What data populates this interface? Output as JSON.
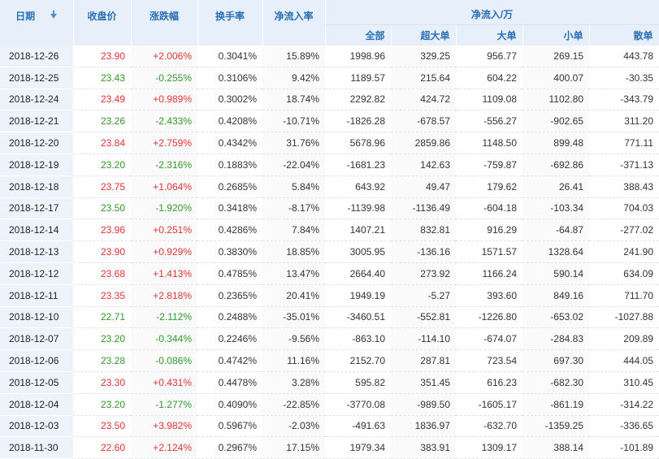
{
  "headers": {
    "date": "日期",
    "close": "收盘价",
    "change": "涨跌幅",
    "turnover": "换手率",
    "net_rate": "净流入率",
    "net_flow_group": "净流入/万",
    "all": "全部",
    "xl": "超大单",
    "large": "大单",
    "small": "小单",
    "retail": "散单"
  },
  "colors": {
    "up": "#e03434",
    "down": "#319a29",
    "header_text": "#2a6fb5",
    "header_bg": "#e7f0fa"
  },
  "icons": {
    "sort": "sort-down-icon"
  },
  "rows": [
    {
      "date": "2018-12-26",
      "close": "23.90",
      "change": "+2.006%",
      "turnover": "0.3041%",
      "net_rate": "15.89%",
      "all": "1998.96",
      "xl": "329.25",
      "large": "956.77",
      "small": "269.15",
      "retail": "443.78",
      "dir": "up"
    },
    {
      "date": "2018-12-25",
      "close": "23.43",
      "change": "-0.255%",
      "turnover": "0.3106%",
      "net_rate": "9.42%",
      "all": "1189.57",
      "xl": "215.64",
      "large": "604.22",
      "small": "400.07",
      "retail": "-30.35",
      "dir": "down"
    },
    {
      "date": "2018-12-24",
      "close": "23.49",
      "change": "+0.989%",
      "turnover": "0.3002%",
      "net_rate": "18.74%",
      "all": "2292.82",
      "xl": "424.72",
      "large": "1109.08",
      "small": "1102.80",
      "retail": "-343.79",
      "dir": "up"
    },
    {
      "date": "2018-12-21",
      "close": "23.26",
      "change": "-2.433%",
      "turnover": "0.4208%",
      "net_rate": "-10.71%",
      "all": "-1826.28",
      "xl": "-678.57",
      "large": "-556.27",
      "small": "-902.65",
      "retail": "311.20",
      "dir": "down"
    },
    {
      "date": "2018-12-20",
      "close": "23.84",
      "change": "+2.759%",
      "turnover": "0.4342%",
      "net_rate": "31.76%",
      "all": "5678.96",
      "xl": "2859.86",
      "large": "1148.50",
      "small": "899.48",
      "retail": "771.11",
      "dir": "up"
    },
    {
      "date": "2018-12-19",
      "close": "23.20",
      "change": "-2.316%",
      "turnover": "0.1883%",
      "net_rate": "-22.04%",
      "all": "-1681.23",
      "xl": "142.63",
      "large": "-759.87",
      "small": "-692.86",
      "retail": "-371.13",
      "dir": "down"
    },
    {
      "date": "2018-12-18",
      "close": "23.75",
      "change": "+1.064%",
      "turnover": "0.2685%",
      "net_rate": "5.84%",
      "all": "643.92",
      "xl": "49.47",
      "large": "179.62",
      "small": "26.41",
      "retail": "388.43",
      "dir": "up"
    },
    {
      "date": "2018-12-17",
      "close": "23.50",
      "change": "-1.920%",
      "turnover": "0.3418%",
      "net_rate": "-8.17%",
      "all": "-1139.98",
      "xl": "-1136.49",
      "large": "-604.18",
      "small": "-103.34",
      "retail": "704.03",
      "dir": "down"
    },
    {
      "date": "2018-12-14",
      "close": "23.96",
      "change": "+0.251%",
      "turnover": "0.4286%",
      "net_rate": "7.84%",
      "all": "1407.21",
      "xl": "832.81",
      "large": "916.29",
      "small": "-64.87",
      "retail": "-277.02",
      "dir": "up"
    },
    {
      "date": "2018-12-13",
      "close": "23.90",
      "change": "+0.929%",
      "turnover": "0.3830%",
      "net_rate": "18.85%",
      "all": "3005.95",
      "xl": "-136.16",
      "large": "1571.57",
      "small": "1328.64",
      "retail": "241.90",
      "dir": "up"
    },
    {
      "date": "2018-12-12",
      "close": "23.68",
      "change": "+1.413%",
      "turnover": "0.4785%",
      "net_rate": "13.47%",
      "all": "2664.40",
      "xl": "273.92",
      "large": "1166.24",
      "small": "590.14",
      "retail": "634.09",
      "dir": "up"
    },
    {
      "date": "2018-12-11",
      "close": "23.35",
      "change": "+2.818%",
      "turnover": "0.2365%",
      "net_rate": "20.41%",
      "all": "1949.19",
      "xl": "-5.27",
      "large": "393.60",
      "small": "849.16",
      "retail": "711.70",
      "dir": "up"
    },
    {
      "date": "2018-12-10",
      "close": "22.71",
      "change": "-2.112%",
      "turnover": "0.2488%",
      "net_rate": "-35.01%",
      "all": "-3460.51",
      "xl": "-552.81",
      "large": "-1226.80",
      "small": "-653.02",
      "retail": "-1027.88",
      "dir": "down"
    },
    {
      "date": "2018-12-07",
      "close": "23.20",
      "change": "-0.344%",
      "turnover": "0.2246%",
      "net_rate": "-9.56%",
      "all": "-863.10",
      "xl": "-114.10",
      "large": "-674.07",
      "small": "-284.83",
      "retail": "209.89",
      "dir": "down"
    },
    {
      "date": "2018-12-06",
      "close": "23.28",
      "change": "-0.086%",
      "turnover": "0.4742%",
      "net_rate": "11.16%",
      "all": "2152.70",
      "xl": "287.81",
      "large": "723.54",
      "small": "697.30",
      "retail": "444.05",
      "dir": "down"
    },
    {
      "date": "2018-12-05",
      "close": "23.30",
      "change": "+0.431%",
      "turnover": "0.4478%",
      "net_rate": "3.28%",
      "all": "595.82",
      "xl": "351.45",
      "large": "616.23",
      "small": "-682.30",
      "retail": "310.45",
      "dir": "up"
    },
    {
      "date": "2018-12-04",
      "close": "23.20",
      "change": "-1.277%",
      "turnover": "0.4090%",
      "net_rate": "-22.85%",
      "all": "-3770.08",
      "xl": "-989.50",
      "large": "-1605.17",
      "small": "-861.19",
      "retail": "-314.22",
      "dir": "down"
    },
    {
      "date": "2018-12-03",
      "close": "23.50",
      "change": "+3.982%",
      "turnover": "0.5967%",
      "net_rate": "-2.03%",
      "all": "-491.63",
      "xl": "1836.97",
      "large": "-632.70",
      "small": "-1359.25",
      "retail": "-336.65",
      "dir": "up"
    },
    {
      "date": "2018-11-30",
      "close": "22.60",
      "change": "+2.124%",
      "turnover": "0.2967%",
      "net_rate": "17.15%",
      "all": "1979.34",
      "xl": "383.91",
      "large": "1309.17",
      "small": "388.14",
      "retail": "-101.89",
      "dir": "up"
    }
  ]
}
